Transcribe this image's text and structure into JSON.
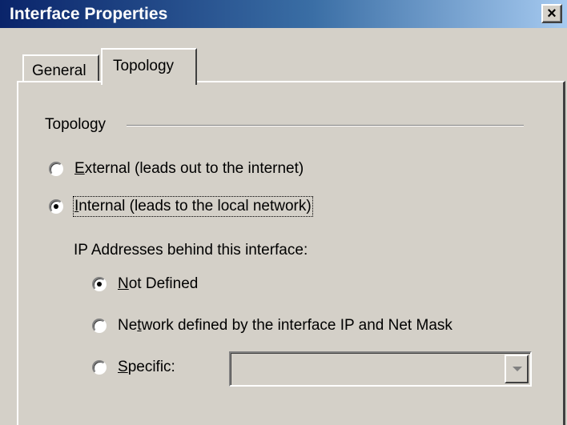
{
  "window": {
    "title": "Interface Properties",
    "close_label": "✕"
  },
  "tabs": [
    {
      "label": "General",
      "selected": false
    },
    {
      "label": "Topology",
      "selected": true
    }
  ],
  "topology_group": {
    "label": "Topology",
    "options": [
      {
        "mnemonic": "E",
        "rest": "xternal (leads out to the internet)",
        "checked": false
      },
      {
        "mnemonic": "I",
        "rest": "nternal (leads to the local network)",
        "checked": true
      }
    ]
  },
  "ip_section": {
    "label": "IP Addresses behind this interface:",
    "options": [
      {
        "before": "",
        "mnemonic": "N",
        "rest": "ot Defined",
        "checked": true
      },
      {
        "before": "Ne",
        "mnemonic": "t",
        "rest": "work defined by the interface IP and Net Mask",
        "checked": false
      },
      {
        "before": "",
        "mnemonic": "S",
        "rest": "pecific:",
        "checked": false
      }
    ],
    "specific_value": ""
  }
}
